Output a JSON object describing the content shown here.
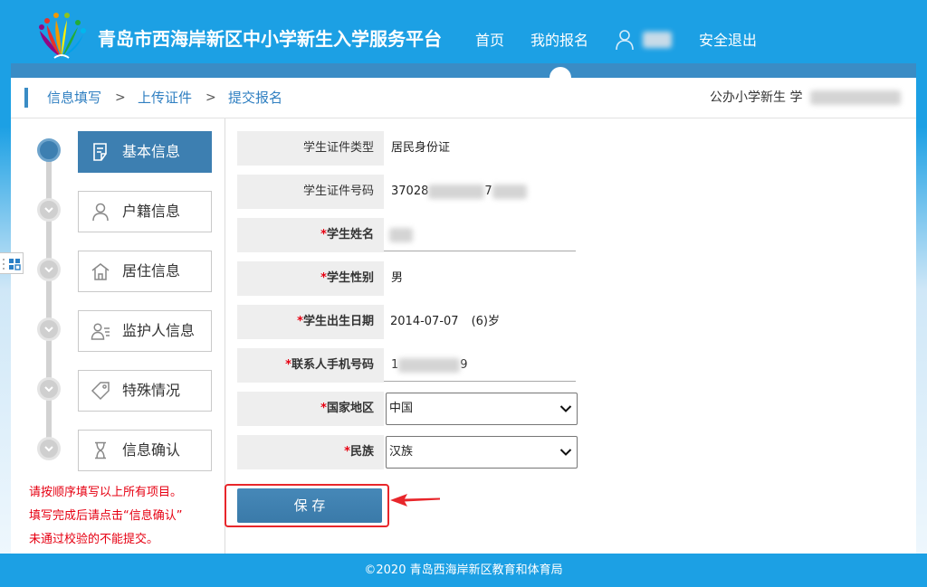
{
  "header": {
    "title": "青岛市西海岸新区中小学新生入学服务平台",
    "nav": [
      {
        "label": "首页",
        "active": false
      },
      {
        "label": "我的报名",
        "active": true
      }
    ],
    "user_icon": "user-icon",
    "logout_label": "安全退出"
  },
  "breadcrumb": {
    "items": [
      "信息填写",
      "上传证件",
      "提交报名"
    ],
    "separator": ">",
    "category_text": "公办小学新生 学"
  },
  "sidebar": {
    "steps": [
      {
        "label": "基本信息",
        "icon": "form-icon",
        "active": true
      },
      {
        "label": "户籍信息",
        "icon": "person-icon",
        "active": false
      },
      {
        "label": "居住信息",
        "icon": "house-icon",
        "active": false
      },
      {
        "label": "监护人信息",
        "icon": "guardian-icon",
        "active": false
      },
      {
        "label": "特殊情况",
        "icon": "tag-icon",
        "active": false
      },
      {
        "label": "信息确认",
        "icon": "hourglass-icon",
        "active": false
      }
    ],
    "notes": [
      "请按顺序填写以上所有项目。",
      "填写完成后请点击“信息确认”",
      "未通过校验的不能提交。"
    ],
    "float_widget_icon": "grid-icon"
  },
  "form": {
    "required_mark": "*",
    "rows": [
      {
        "label": "学生证件类型",
        "required": false,
        "value": "居民身份证"
      },
      {
        "label": "学生证件号码",
        "required": false,
        "value_visible_start": "37028",
        "value_visible_fragment": "7"
      },
      {
        "label": "学生姓名",
        "required": true
      },
      {
        "label": "学生性别",
        "required": true,
        "value": "男"
      },
      {
        "label": "学生出生日期",
        "required": true,
        "value": "2014-07-07",
        "age": "(6)岁"
      },
      {
        "label": "联系人手机号码",
        "required": true,
        "value_visible_start": "1",
        "value_visible_end": "9"
      },
      {
        "label": "国家地区",
        "required": true,
        "selected": "中国"
      },
      {
        "label": "民族",
        "required": true,
        "selected": "汉族"
      }
    ],
    "save_label": "保 存"
  },
  "footer": {
    "copyright": "©2020 青岛西海岸新区教育和体育局"
  },
  "colors": {
    "header-blue": "#1ca0e4",
    "band-blue": "#3a8cc5",
    "accent-blue": "#3d7fb1",
    "link-blue": "#2f7fc1",
    "required-red": "#e60012",
    "label-bg": "#eeeeee"
  }
}
